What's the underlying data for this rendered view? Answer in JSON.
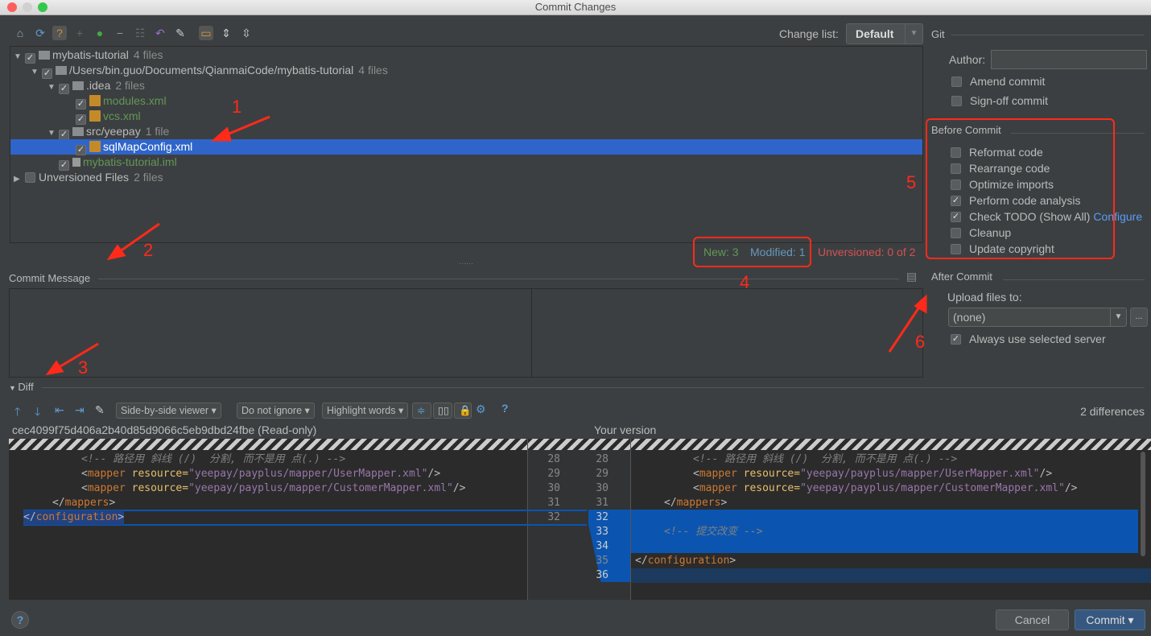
{
  "window": {
    "title": "Commit Changes"
  },
  "changelist": {
    "label": "Change list:",
    "value": "Default"
  },
  "tree": [
    {
      "label": "mybatis-tutorial",
      "count": "4 files",
      "level": 0,
      "checked": true,
      "kind": "module",
      "expanded": true
    },
    {
      "label": "/Users/bin.guo/Documents/QianmaiCode/mybatis-tutorial",
      "count": "4 files",
      "level": 1,
      "checked": true,
      "kind": "folder",
      "expanded": true
    },
    {
      "label": ".idea",
      "count": "2 files",
      "level": 2,
      "checked": true,
      "kind": "folder",
      "expanded": true
    },
    {
      "label": "modules.xml",
      "count": "",
      "level": 3,
      "checked": true,
      "kind": "xml-new"
    },
    {
      "label": "vcs.xml",
      "count": "",
      "level": 3,
      "checked": true,
      "kind": "xml-new"
    },
    {
      "label": "src/yeepay",
      "count": "1 file",
      "level": 2,
      "checked": true,
      "kind": "folder",
      "expanded": true
    },
    {
      "label": "sqlMapConfig.xml",
      "count": "",
      "level": 3,
      "checked": true,
      "kind": "xml-selected"
    },
    {
      "label": "mybatis-tutorial.iml",
      "count": "",
      "level": 2,
      "checked": true,
      "kind": "iml-new"
    },
    {
      "label": "Unversioned Files",
      "count": "2 files",
      "level": 0,
      "checked": false,
      "kind": "group",
      "expanded": false
    }
  ],
  "status": {
    "new": "New: 3",
    "modified": "Modified: 1",
    "unversioned": "Unversioned: 0 of 2"
  },
  "commit_message": {
    "label": "Commit Message",
    "value": ""
  },
  "git": {
    "title": "Git",
    "author_label": "Author:",
    "author_value": "",
    "amend": "Amend commit",
    "signoff": "Sign-off commit"
  },
  "before_commit": {
    "title": "Before Commit",
    "items": [
      {
        "label": "Reformat code",
        "checked": false
      },
      {
        "label": "Rearrange code",
        "checked": false
      },
      {
        "label": "Optimize imports",
        "checked": false
      },
      {
        "label": "Perform code analysis",
        "checked": true
      },
      {
        "label": "Check TODO (Show All)",
        "checked": true,
        "link": "Configure"
      },
      {
        "label": "Cleanup",
        "checked": false
      },
      {
        "label": "Update copyright",
        "checked": false
      }
    ]
  },
  "after_commit": {
    "title": "After Commit",
    "upload_label": "Upload files to:",
    "upload_value": "(none)",
    "more": "...",
    "always": "Always use selected server"
  },
  "diff": {
    "label": "Diff",
    "viewer": "Side-by-side viewer",
    "ignore": "Do not ignore",
    "highlight": "Highlight words",
    "help": "?",
    "count": "2 differences",
    "left_title": "cec4099f75d406a2b40d85d9066c5eb9dbd24fbe (Read-only)",
    "right_title": "Your version",
    "left_lines": [
      "28",
      "29",
      "30",
      "31",
      "32"
    ],
    "right_lines": [
      "28",
      "29",
      "30",
      "31",
      "32",
      "33",
      "34",
      "35",
      "36"
    ],
    "code": {
      "comment1": "<!-- 路径用 斜线 (/)  分割, 而不是用 点(.) -->",
      "lt": "<",
      "mapper": "mapper",
      "resource": " resource=",
      "val1": "\"yeepay/payplus/mapper/UserMapper.xml\"",
      "val2": "\"yeepay/payplus/mapper/CustomerMapper.xml\"",
      "close": "/>",
      "endmap": "</",
      "mappers": "mappers",
      "gt": ">",
      "configuration": "configuration",
      "comment2": "<!-- 提交改变 -->"
    }
  },
  "buttons": {
    "help": "?",
    "cancel": "Cancel",
    "commit": "Commit ▾"
  },
  "annotations": [
    "1",
    "2",
    "3",
    "4",
    "5",
    "6"
  ],
  "colors": {
    "selection": "#2f65ca",
    "new": "#629755",
    "modified": "#6897bb",
    "unversioned": "#d25252",
    "annotation": "#ff2a1a",
    "link": "#589df6",
    "diff_inserted": "#0b55b0"
  }
}
